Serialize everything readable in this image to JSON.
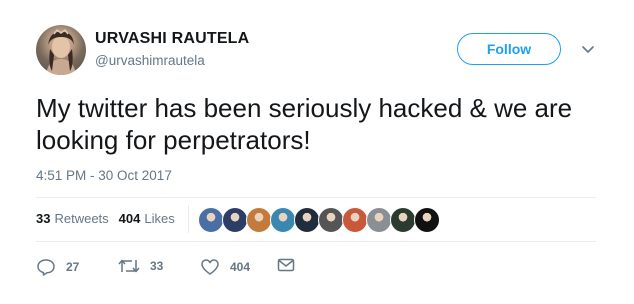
{
  "user": {
    "name": "URVASHI RAUTELA",
    "handle": "@urvashimrautela"
  },
  "follow_label": "Follow",
  "tweet": {
    "text": "My twitter has been seriously hacked & we are looking for perpetrators!",
    "timestamp": "4:51 PM - 30 Oct 2017"
  },
  "stats": {
    "retweets_count": "33",
    "retweets_label": "Retweets",
    "likes_count": "404",
    "likes_label": "Likes"
  },
  "actions": {
    "reply_count": "27",
    "retweet_count": "33",
    "like_count": "404"
  },
  "icons": {
    "reply": "reply-icon",
    "retweet": "retweet-icon",
    "like": "heart-icon",
    "dm": "envelope-icon",
    "caret": "chevron-down-icon"
  },
  "colors": {
    "accent": "#1da1f2",
    "text": "#14171a",
    "muted": "#657786"
  },
  "liker_avatars": [
    {
      "name": "liker-1",
      "color": "#4a6fa5"
    },
    {
      "name": "liker-2",
      "color": "#2c3e66"
    },
    {
      "name": "liker-3",
      "color": "#c47a3b"
    },
    {
      "name": "liker-4",
      "color": "#3a87b0"
    },
    {
      "name": "liker-5",
      "color": "#1f2d3d"
    },
    {
      "name": "liker-6",
      "color": "#555555"
    },
    {
      "name": "liker-7",
      "color": "#c8583a"
    },
    {
      "name": "liker-8",
      "color": "#8a8f96"
    },
    {
      "name": "liker-9",
      "color": "#2b3b2f"
    },
    {
      "name": "liker-10",
      "color": "#111111"
    }
  ]
}
